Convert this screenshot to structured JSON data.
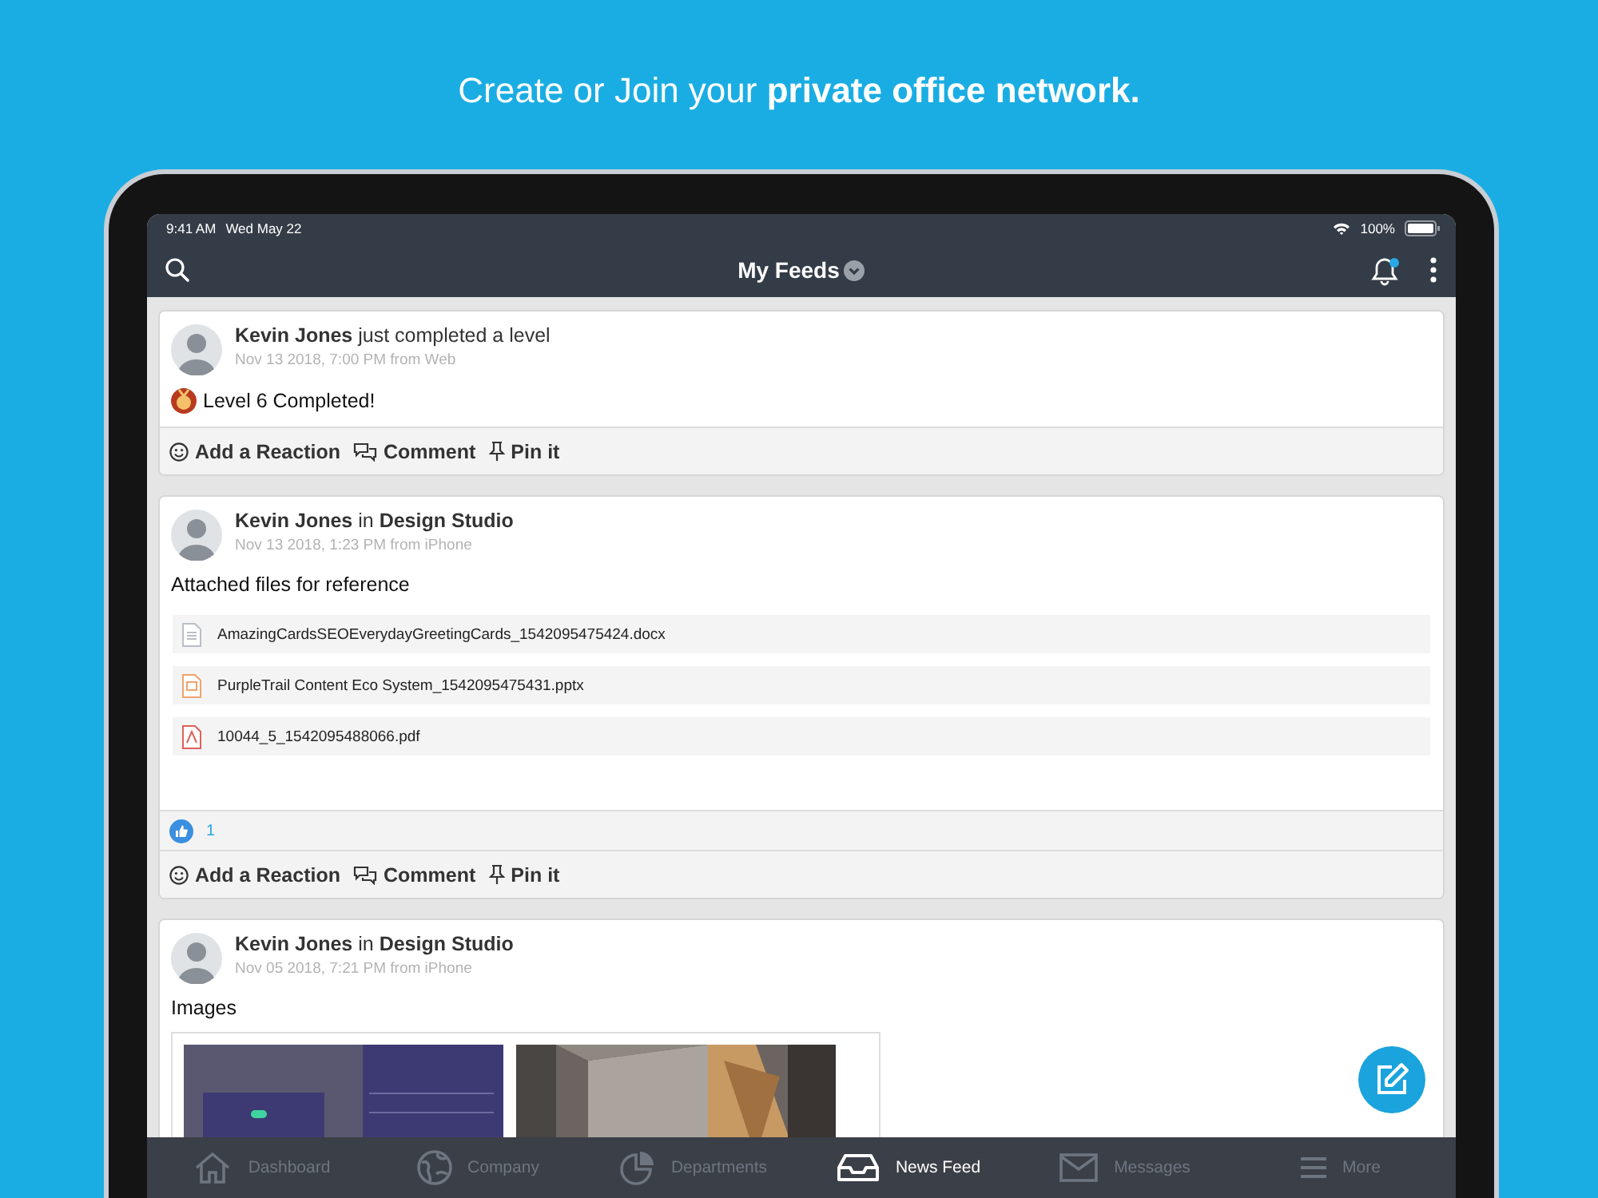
{
  "headline": "Create or Join your **private office network.**",
  "status_bar": {
    "time": "9:41 AM",
    "date": "Wed May 22",
    "battery": "100%"
  },
  "header": {
    "title": "My Feeds"
  },
  "posts": [
    {
      "kind": "achievement",
      "heading": "**Kevin Jones** just completed a level",
      "timestamp": "Nov 13 2018, 7:00 PM from Web",
      "body": "Level 6 Completed!",
      "actions": [
        {
          "kind": "reaction",
          "label": "Add a Reaction"
        },
        {
          "kind": "comment",
          "label": "Comment"
        },
        {
          "kind": "pin",
          "label": "Pin it"
        }
      ]
    },
    {
      "kind": "files",
      "heading": "**Kevin Jones** in **Design Studio**",
      "timestamp": "Nov 13 2018, 1:23 PM from iPhone",
      "body": "Attached files for reference",
      "files": [
        {
          "name": "AmazingCardsSEOEverydayGreetingCards_1542095475424.docx",
          "kind": "document"
        },
        {
          "name": "PurpleTrail Content Eco System_1542095475431.pptx",
          "kind": "slides"
        },
        {
          "name": "10044_5_1542095488066.pdf",
          "kind": "pdf"
        }
      ],
      "likes": "1",
      "actions": [
        {
          "kind": "reaction",
          "label": "Add a Reaction"
        },
        {
          "kind": "comment",
          "label": "Comment"
        },
        {
          "kind": "pin",
          "label": "Pin it"
        }
      ]
    },
    {
      "kind": "images",
      "heading": "**Kevin Jones** in **Design Studio**",
      "timestamp": "Nov 05 2018, 7:21 PM from iPhone",
      "body": "Images"
    }
  ],
  "tabs": [
    {
      "kind": "home",
      "label": "Dashboard",
      "selected": false
    },
    {
      "kind": "globe",
      "label": "Company",
      "selected": false
    },
    {
      "kind": "pie",
      "label": "Departments",
      "selected": false
    },
    {
      "kind": "inbox",
      "label": "News Feed",
      "selected": true
    },
    {
      "kind": "mail",
      "label": "Messages",
      "selected": false
    },
    {
      "kind": "menu",
      "label": "More",
      "selected": false
    }
  ]
}
